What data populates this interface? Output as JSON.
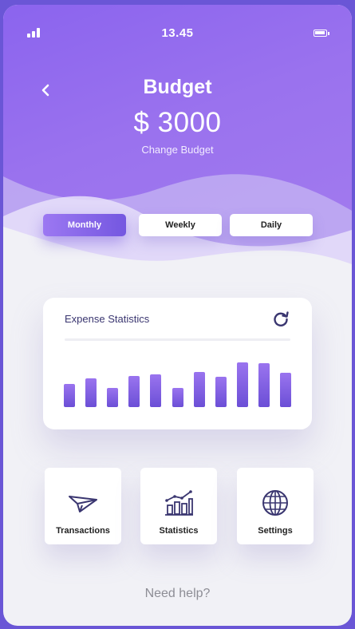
{
  "status_bar": {
    "time": "13.45"
  },
  "header": {
    "title": "Budget",
    "amount": "$ 3000",
    "change_budget": "Change Budget"
  },
  "period_tabs": [
    {
      "label": "Monthly",
      "active": true
    },
    {
      "label": "Weekly",
      "active": false
    },
    {
      "label": "Daily",
      "active": false
    }
  ],
  "stats": {
    "title": "Expense Statistics",
    "bar_levels": [
      0.52,
      0.65,
      0.43,
      0.69,
      0.74,
      0.43,
      0.78,
      0.67,
      1.0,
      0.98,
      0.76
    ]
  },
  "actions": [
    {
      "label": "Transactions",
      "icon": "paper-plane-icon"
    },
    {
      "label": "Statistics",
      "icon": "bar-chart-icon"
    },
    {
      "label": "Settings",
      "icon": "globe-icon"
    }
  ],
  "footer": {
    "help": "Need help?"
  },
  "colors": {
    "accent": "#8b64ee",
    "accent_dark": "#6b4fd6",
    "icon_navy": "#3a3670"
  }
}
